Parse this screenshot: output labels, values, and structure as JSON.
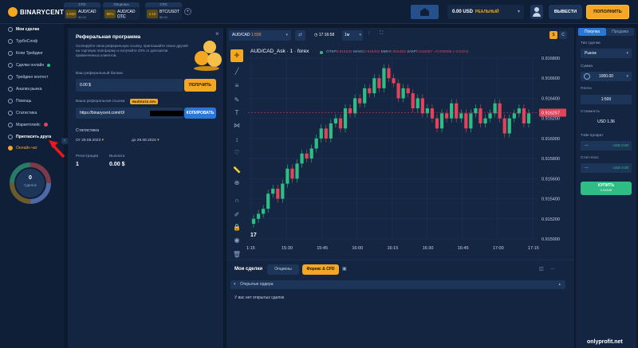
{
  "logo": {
    "text": "BINARYCENT"
  },
  "asset_tabs": [
    {
      "category": "CFD",
      "percent": "1:500",
      "name": "AUD/CAD",
      "sub": "$0.00"
    },
    {
      "category": "Опционы",
      "percent": "95%",
      "name": "AUD/CAD OTC",
      "sub": "$0.00"
    },
    {
      "category": "CFD",
      "percent": "1:10",
      "name": "BTC/USDT",
      "sub": "$0.00"
    }
  ],
  "header": {
    "balance_amount": "0.00 USD",
    "balance_type": "РЕАЛЬНЫЙ",
    "withdraw_label": "ВЫВЕСТИ",
    "deposit_label": "ПОПОЛНИТЬ"
  },
  "sidebar": {
    "items": [
      {
        "label": "Мои сделки"
      },
      {
        "label": "ТурбоСлоф"
      },
      {
        "label": "Копи Трейдинг"
      },
      {
        "label": "Сделки онлайн"
      },
      {
        "label": "Трейдинг контест"
      },
      {
        "label": "Анализ рынка"
      },
      {
        "label": "Помощь"
      },
      {
        "label": "Статистика"
      },
      {
        "label": "Маркетплейс"
      },
      {
        "label": "Пригласить друга"
      },
      {
        "label": "Онлайн чат"
      }
    ],
    "ring_value": "0",
    "ring_label": "Сделок",
    "ring_colors": [
      "#4d6aa6",
      "#6d5a2a",
      "#2a7a6a",
      "#7a3a4a"
    ]
  },
  "referral": {
    "title": "Реферальная программа",
    "description": "Скопируйте свою реферальную ссылку, приглашайте своих друзей на торговую платформу и получайте 20% от депозитов привлеченных клиентов.",
    "balance_label": "Ваш реферальный баланс",
    "balance_value": "0.00 $",
    "get_button": "ПОЛУЧИТЬ",
    "link_label": "Ваша реферальная ссылка",
    "link_badge": "ВЫПЛАТА 20%",
    "link_value": "https://binarycent.com/r0/",
    "copy_button": "КОПИРОВАТЬ",
    "stats_title": "Статистика",
    "date_from": "От 29.08.2023",
    "date_to": "до 29.08.2024",
    "registrations_label": "Регистрации",
    "registrations_value": "1",
    "payout_label": "Выплата",
    "payout_value": "0.00 $"
  },
  "chart_toolbar": {
    "asset": "AUD/CAD",
    "leverage": "1:500",
    "time": "17:16:58",
    "timeframe": "1м",
    "currency_dollar": "$",
    "currency_c": "C"
  },
  "chart_header": {
    "symbol": "AUD/CAD_Ask · 1 · forex",
    "open_label": "ОТКР",
    "open": "0.916342",
    "high_label": "МАКС",
    "high": "0.916452",
    "low_label": "МИН",
    "low": "0.916153",
    "close_label": "ЗАКР",
    "close": "0.916257",
    "change": "−0.000085 (−0.01%)"
  },
  "chart_data": {
    "type": "candlestick",
    "y_ticks": [
      "0.916800",
      "0.916600",
      "0.916400",
      "0.916200",
      "0.916000",
      "0.915800",
      "0.915600",
      "0.915400",
      "0.915200",
      "0.915000"
    ],
    "x_ticks": [
      "1:15",
      "15:30",
      "15:45",
      "16:00",
      "16:15",
      "16:30",
      "16:45",
      "17:00",
      "17:15"
    ],
    "ylim": [
      0.915,
      0.9168
    ],
    "current_price": "0.916257",
    "close_series": [
      0.9152,
      0.91525,
      0.9153,
      0.91545,
      0.9155,
      0.9154,
      0.91555,
      0.9157,
      0.9156,
      0.91575,
      0.91585,
      0.9158,
      0.9159,
      0.916,
      0.9161,
      0.916,
      0.91615,
      0.9162,
      0.9161,
      0.9163,
      0.91625,
      0.9164,
      0.91635,
      0.9165,
      0.91645,
      0.9166,
      0.9165,
      0.9167,
      0.9166,
      0.91655,
      0.9164,
      0.9165,
      0.91645,
      0.9163,
      0.9164,
      0.91625,
      0.9163,
      0.9162,
      0.9161,
      0.91625,
      0.9162,
      0.91635,
      0.9162,
      0.91625,
      0.9161,
      0.91625,
      0.9163,
      0.91615,
      0.9162,
      0.91625,
      0.91635,
      0.9162,
      0.91605,
      0.9162,
      0.91625,
      0.9163,
      0.91615,
      0.91625
    ]
  },
  "deals": {
    "title": "Мои сделки",
    "tab_options": "Опционы",
    "tab_forex": "Форекс & CFD",
    "open_orders": "Открытые ордера",
    "empty_text": "У вас нет открытых сделок"
  },
  "order_panel": {
    "tab_buy": "Покупка",
    "tab_sell": "Продажа",
    "order_type_label": "Тип сделки",
    "order_type_value": "Рынок",
    "amount_label": "Сумма",
    "amount_value": "1000.00",
    "leverage_label": "Плечо",
    "leverage_value": "1:500",
    "cost_label": "Стоимость",
    "cost_value": "USD 1.36",
    "tp_label": "Тэйк-профит",
    "tp_placeholder": "—",
    "tp_value": "USD 0.00",
    "sl_label": "Стоп-лосс",
    "sl_placeholder": "—",
    "sl_value": "USD 0.00",
    "buy_label": "КУПИТЬ",
    "buy_price": "0.91626"
  },
  "watermark": "onlyprofit.net"
}
